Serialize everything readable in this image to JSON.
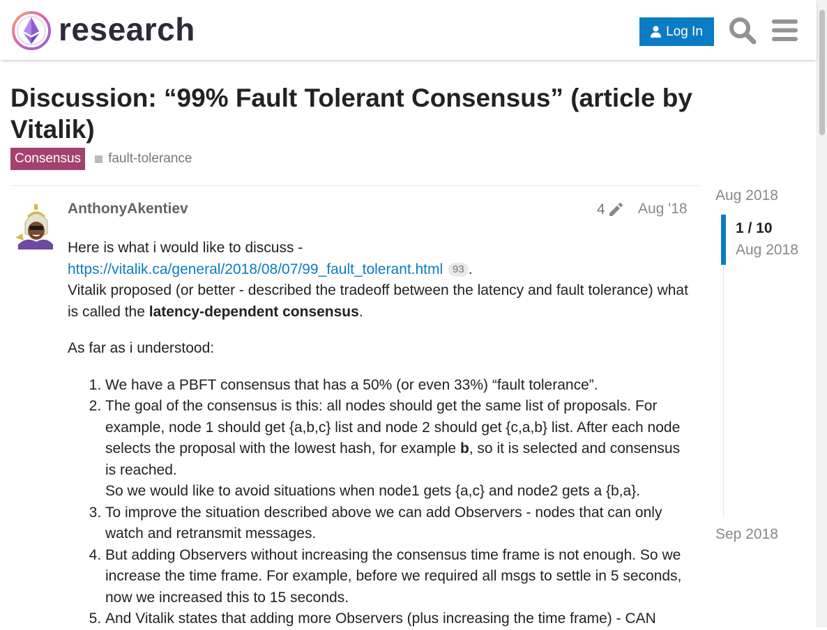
{
  "header": {
    "logo_text": "research",
    "login_label": "Log In",
    "icons": [
      "user-icon",
      "search-icon",
      "hamburger-menu-icon"
    ]
  },
  "topic": {
    "title": "Discussion: “99% Fault Tolerant Consensus” (article by Vitalik)",
    "category": "Consensus",
    "tag": "fault-tolerance"
  },
  "post": {
    "username": "AnthonyAkentiev",
    "edit_count": "4",
    "date": "Aug '18",
    "intro": "Here is what i would like to discuss -",
    "link_text": "https://vitalik.ca/general/2018/08/07/99_fault_tolerant.html",
    "link_clicks": "93",
    "link_suffix": ".",
    "paragraph2_prefix": "Vitalik proposed (or better - described the tradeoff between the latency and fault tolerance) what is called the ",
    "paragraph2_bold": "latency-dependent consensus",
    "paragraph2_suffix": ".",
    "paragraph3": "As far as i understood:",
    "list": {
      "item1": "We have a PBFT consensus that has a 50% (or even 33%) “fault tolerance”.",
      "item2_prefix": "The goal of the consensus is this: all nodes should get the same list of proposals. For example, node 1 should get {a,b,c} list and node 2 should get {c,a,b} list. After each node selects the proposal with the lowest hash, for example ",
      "item2_bold": "b",
      "item2_suffix": ", so it is selected and consensus is reached.",
      "item2_line2": "So we would like to avoid situations when node1 gets {a,c} and node2 gets a {b,a}.",
      "item3": "To improve the situation described above we can add Observers - nodes that can only watch and retransmit messages.",
      "item4": "But adding Observers without increasing the consensus time frame is not enough. So we increase the time frame. For example, before we required all msgs to settle in 5 seconds, now we increased this to 15 seconds.",
      "item5": "And Vitalik states that adding more Observers (plus increasing the time frame) - CAN"
    }
  },
  "timeline": {
    "start_date": "Aug 2018",
    "position": "1 / 10",
    "current_date": "Aug 2018",
    "end_date": "Sep 2018"
  },
  "colors": {
    "brand_blue": "#0a7cc3",
    "category_badge": "#a5416e",
    "text": "#222222",
    "muted": "#888888"
  }
}
